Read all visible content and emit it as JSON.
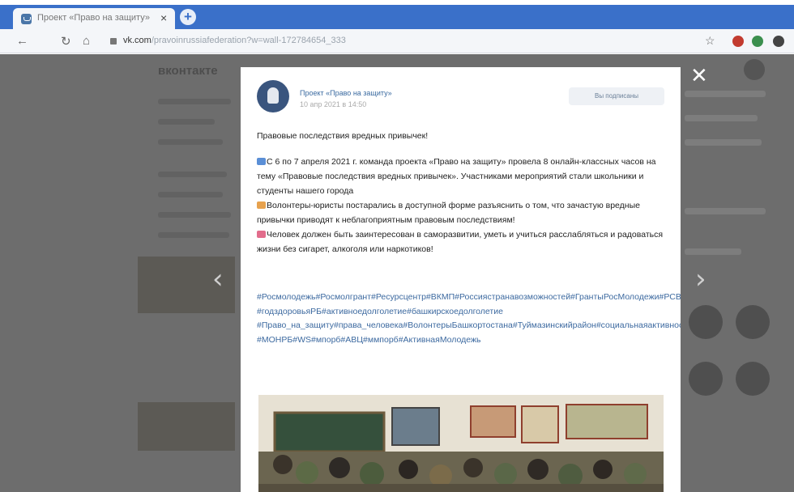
{
  "browser": {
    "tab_title": "Проект «Право на защиту»",
    "url_domain": "vk.com",
    "url_path": "/pravoinrussiafederation?w=wall-172784654_333"
  },
  "vk": {
    "logo_text": "вконтакте"
  },
  "post": {
    "author": "Проект «Право на защиту»",
    "date": "10 апр 2021 в 14:50",
    "subscribe_label": "Вы подписаны",
    "title": "Правовые последствия вредных привычек!",
    "paragraph1": "С 6 по 7 апреля 2021 г. команда проекта «Право на защиту» провела 8 онлайн-классных часов на тему «Правовые последствия вредных привычек». Участниками мероприятий стали школьники и студенты нашего города",
    "paragraph2": "Волонтеры-юристы постарались в доступной форме разъяснить о том, что зачастую вредные привычки приводят к неблагоприятным правовым последствиям!",
    "paragraph3": "Человек должен быть заинтересован в саморазвитии, уметь и учиться расслабляться и радоваться жизни без сигарет, алкоголя или наркотиков!",
    "hashtags": "#Росмолодежь#Росмолгрант#Ресурсцентр#ВКМП#Россиястранавозможностей#ГрантыРосМолодежи#РСВ #годздоровьяРБ#активноедолголетие#башкирскоедолголетие #Право_на_защиту#права_человека#ВолонтерыБашкортостана#Туймазинскийрайон#социальнаяактивность#мпорб#молодыепрофессионалы #МОНРБ#WS#мпорб#АВЦ#ммпорб#АктивнаяМолодежь"
  },
  "colors": {
    "browser_blue": "#3a70c9",
    "overlay": "#6d6d6d",
    "link": "#3d6aa0"
  }
}
